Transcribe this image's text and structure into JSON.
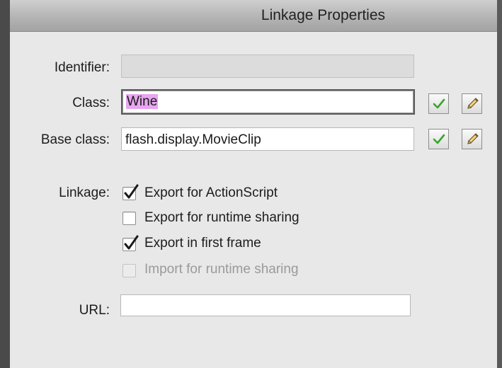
{
  "window": {
    "title": "Linkage Properties"
  },
  "identifier": {
    "label": "Identifier:",
    "value": ""
  },
  "class_field": {
    "label": "Class:",
    "value": "Wine"
  },
  "base_class": {
    "label": "Base class:",
    "value": "flash.display.MovieClip"
  },
  "linkage": {
    "label": "Linkage:",
    "options": [
      {
        "label": "Export for ActionScript",
        "checked": true,
        "enabled": true
      },
      {
        "label": "Export for runtime sharing",
        "checked": false,
        "enabled": true
      },
      {
        "label": "Export in first frame",
        "checked": true,
        "enabled": true
      },
      {
        "label": "Import for runtime sharing",
        "checked": false,
        "enabled": false
      }
    ]
  },
  "url": {
    "label": "URL:",
    "value": ""
  },
  "icons": {
    "validate": "check-icon",
    "edit": "pencil-icon",
    "check_color": "#3aa52c"
  }
}
